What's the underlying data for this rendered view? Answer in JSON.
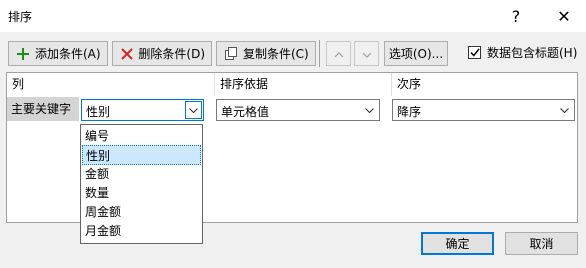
{
  "window": {
    "title": "排序",
    "help_label": "?",
    "close_label": "✕"
  },
  "toolbar": {
    "add_label": "添加条件(A)",
    "delete_label": "删除条件(D)",
    "copy_label": "复制条件(C)",
    "options_label": "选项(O)...",
    "header_checkbox_label": "数据包含标题(H)",
    "header_checkbox_checked": true,
    "icons": {
      "add": "plus-icon",
      "delete": "x-icon",
      "copy": "copy-icon",
      "move_up": "chevron-up-icon",
      "move_down": "chevron-down-icon"
    }
  },
  "grid": {
    "headers": {
      "column": "列",
      "sort_on": "排序依据",
      "order": "次序"
    },
    "rows": [
      {
        "label": "主要关键字",
        "column_value": "性别",
        "sort_on_value": "单元格值",
        "order_value": "降序"
      }
    ]
  },
  "dropdown": {
    "options": [
      "编号",
      "性别",
      "金额",
      "数量",
      "周金额",
      "月金额"
    ],
    "selected": "性别"
  },
  "footer": {
    "ok_label": "确定",
    "cancel_label": "取消"
  },
  "colors": {
    "accent": "#0078d7",
    "selected_option_bg": "#cce8ff",
    "add_icon": "#1a8f1a",
    "delete_icon": "#d42222"
  }
}
